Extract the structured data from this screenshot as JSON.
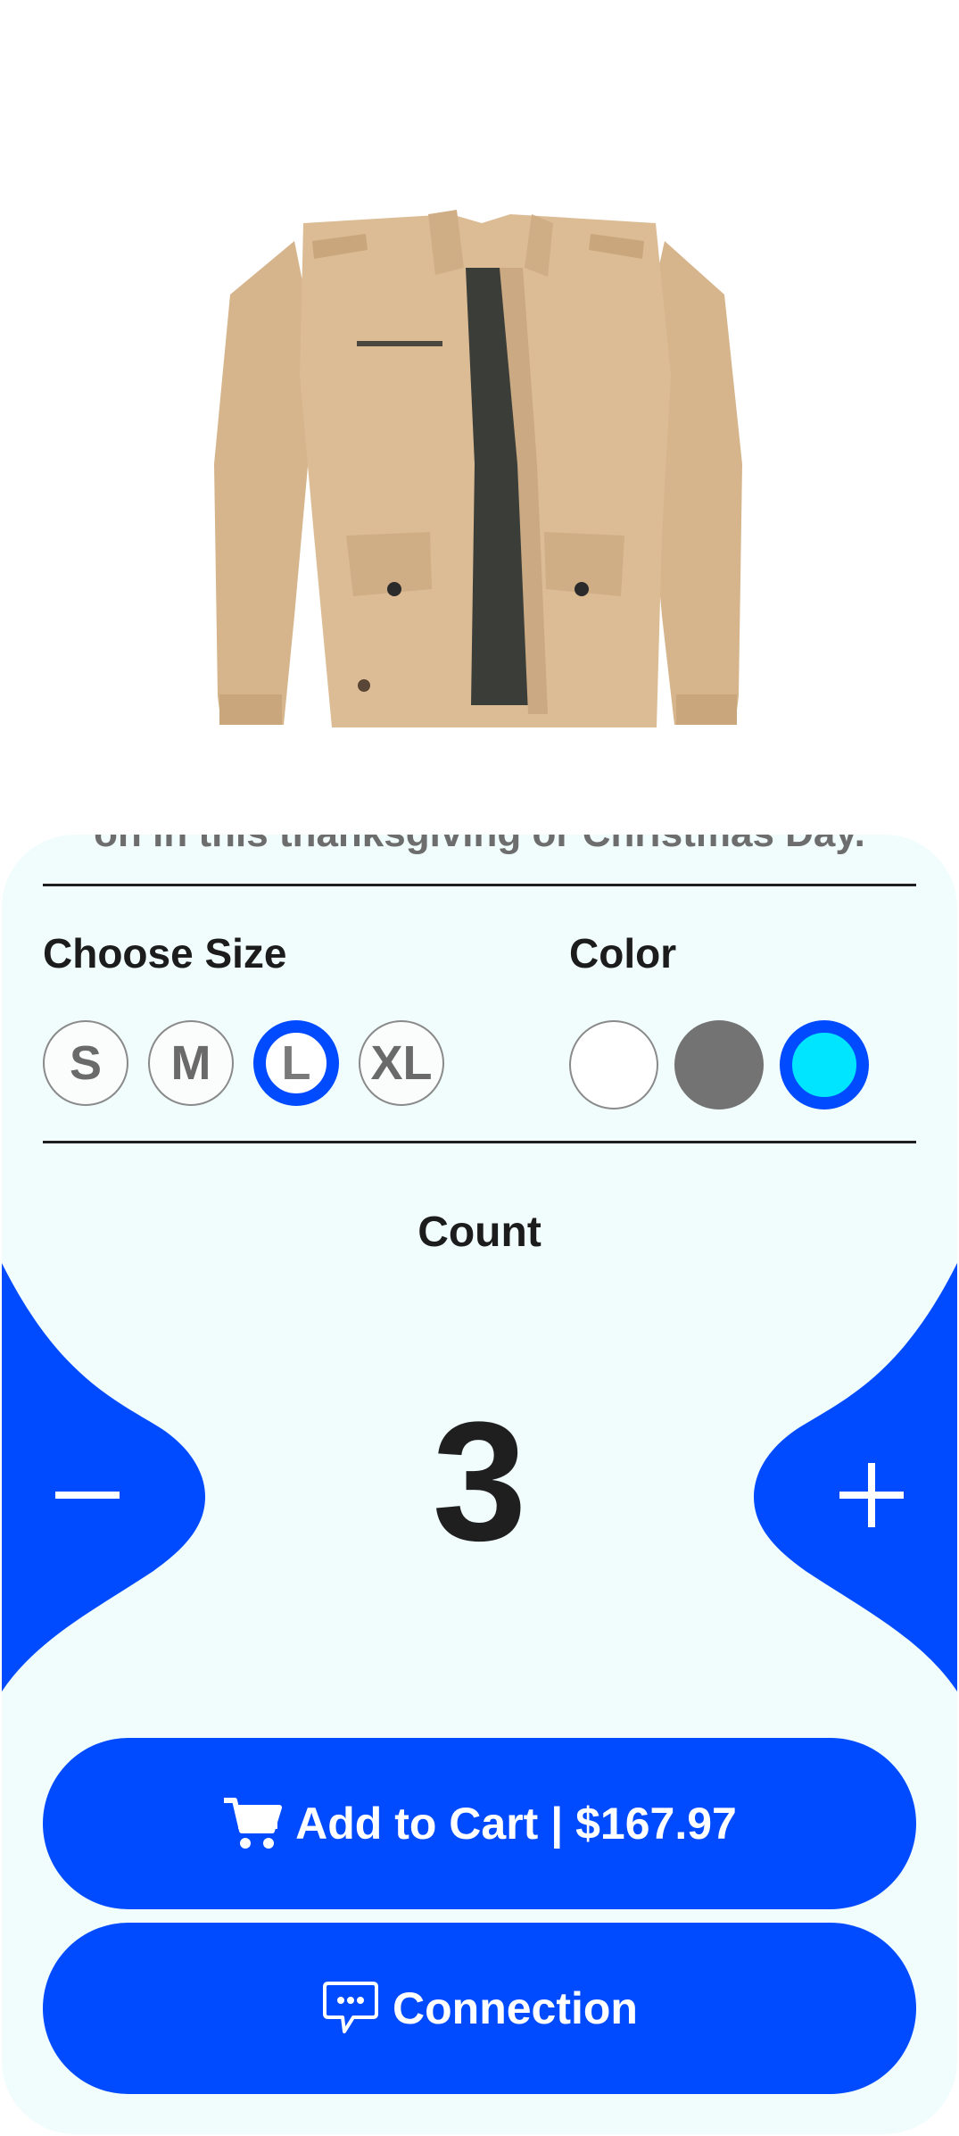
{
  "product": {
    "image_alt": "Khaki jacket",
    "description_tail": "on in this thanksgiving or Christmas Day."
  },
  "size": {
    "title": "Choose Size",
    "options": [
      "S",
      "M",
      "L",
      "XL"
    ],
    "selected": "L"
  },
  "color": {
    "title": "Color",
    "options": [
      "#ffffff",
      "#737373",
      "#00e5ff"
    ],
    "selected": "#00e5ff"
  },
  "quantity": {
    "label": "Count",
    "value": "3",
    "decrement_icon": "minus-icon",
    "increment_icon": "plus-icon"
  },
  "actions": {
    "add_to_cart": "Add to Cart | $167.97",
    "add_to_cart_icon": "cart-icon",
    "connection": "Connection",
    "connection_icon": "chat-bubble-icon"
  },
  "colors": {
    "accent": "#004bff",
    "sheet_background": "#f1fdfd"
  }
}
